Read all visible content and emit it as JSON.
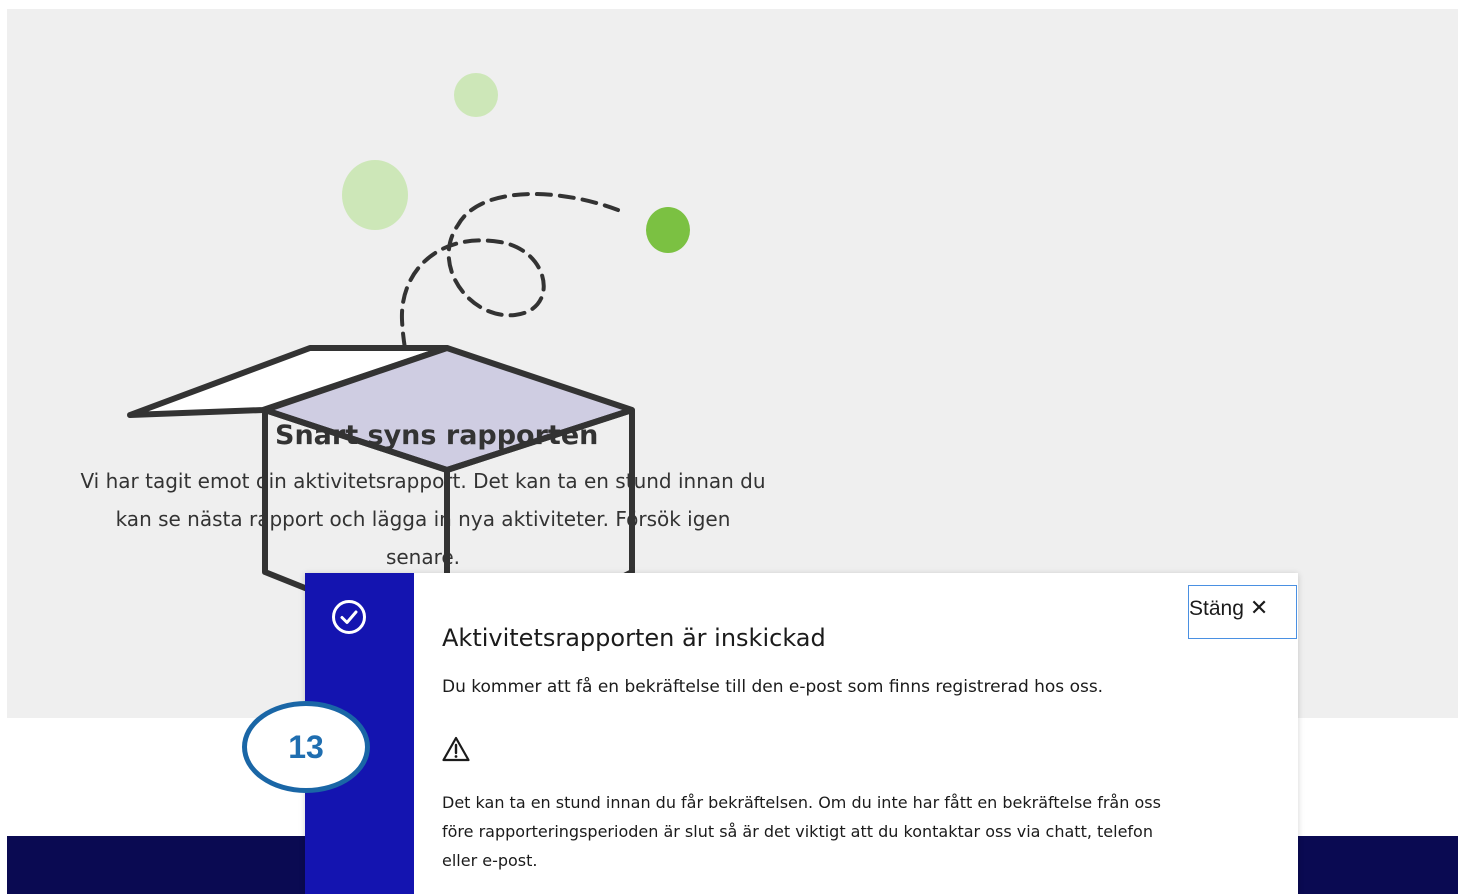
{
  "status": {
    "title": "Snart syns rapporten",
    "text": "Vi har tagit emot din aktivitetsrapport. Det kan ta en stund innan du kan se nästa rapport och lägga in nya aktiviteter. Försök igen senare."
  },
  "dialog": {
    "title": "Aktivitetsrapporten är inskickad",
    "text": "Du kommer att få en bekräftelse till den e-post som finns registrerad hos oss.",
    "warning": "Det kan ta en stund innan du får bekräftelsen. Om du inte har fått en bekräftelse från oss före rapporteringsperioden är slut så är det viktigt att du kontaktar oss via chatt, telefon eller e-post.",
    "close_label": "Stäng",
    "close_glyph": "✕",
    "icons": [
      "check-circle-icon",
      "warning-icon",
      "close-icon"
    ]
  },
  "annotation": {
    "step_number": "13"
  },
  "colors": {
    "dialog_stripe": "#1414b0",
    "footer": "#0a0a52",
    "page_background": "#efefef",
    "badge_border": "#1a66a6",
    "dot_light": "#cde7b8",
    "dot_dark": "#7bc142",
    "box_inner": "#cfcde2"
  }
}
